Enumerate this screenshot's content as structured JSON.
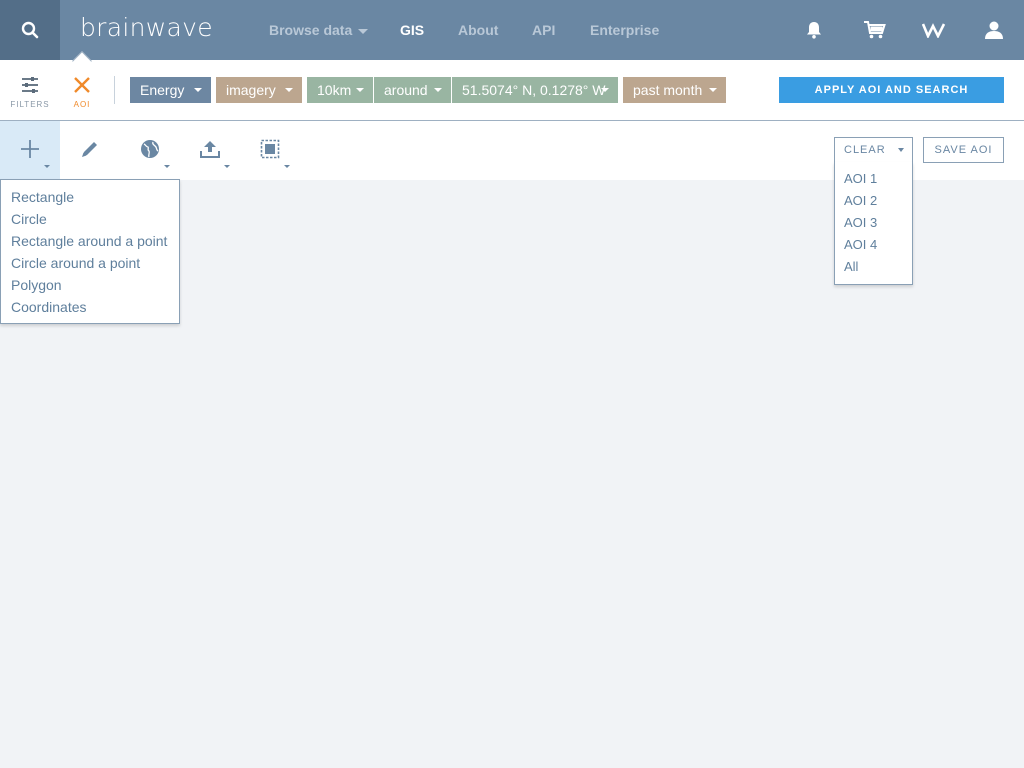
{
  "nav": {
    "logo": "brainwave",
    "browse": "Browse data",
    "gis": "GIS",
    "about": "About",
    "api": "API",
    "enterprise": "Enterprise",
    "icons": [
      "search-icon",
      "bell-icon",
      "cart-icon",
      "wave-logo-icon",
      "user-icon"
    ]
  },
  "filterbar": {
    "filters_label": "FILTERS",
    "aoi_label": "AOI",
    "pills": {
      "energy": "Energy",
      "imagery": "imagery",
      "distance": "10km",
      "relation": "around",
      "coords": "51.5074° N, 0.1278° W",
      "time": "past month"
    },
    "apply": "APPLY AOI AND SEARCH"
  },
  "toolbar": {
    "clear": "CLEAR",
    "save": "SAVE AOI"
  },
  "draw_menu": [
    "Rectangle",
    "Circle",
    "Rectangle around a point",
    "Circle around a point",
    "Polygon",
    "Coordinates"
  ],
  "clear_menu": [
    "AOI 1",
    "AOI 2",
    "AOI 3",
    "AOI 4",
    "All"
  ],
  "colors": {
    "nav_bg": "#6a87a3",
    "accent_orange": "#f08a2a",
    "apply_blue": "#3a9de2",
    "pill_slate": "#6d87a2",
    "pill_tan": "#bca68f",
    "pill_green": "#99b5a2"
  }
}
